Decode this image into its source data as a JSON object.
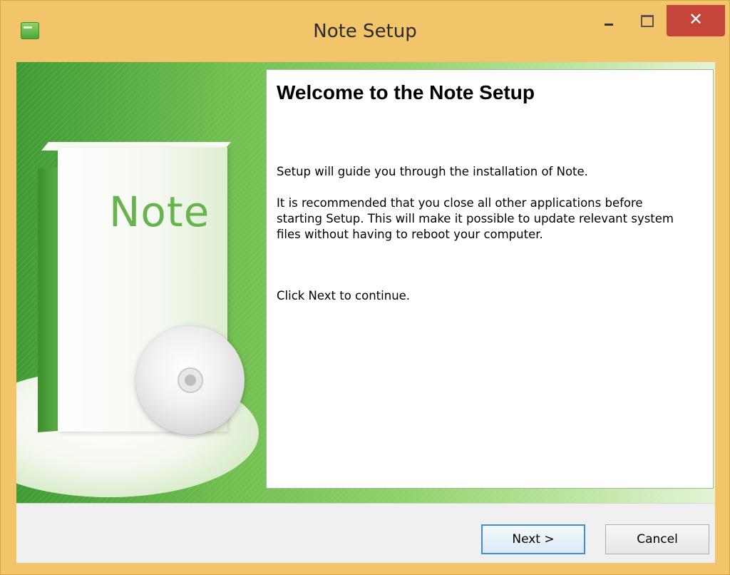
{
  "window": {
    "title": "Note Setup",
    "close_glyph": "✕"
  },
  "banner": {
    "box_brand": "Note"
  },
  "content": {
    "heading": "Welcome to the Note Setup",
    "paragraph_1": "Setup will guide you through the installation of Note.",
    "paragraph_2": "It is recommended that you close all other applications before starting Setup. This will make it possible to update relevant system files without having to reboot your computer.",
    "paragraph_3": "Click Next to continue."
  },
  "buttons": {
    "next_label": "Next >",
    "cancel_label": "Cancel"
  },
  "colors": {
    "titlebar": "#f2c56a",
    "close_button": "#c7443a",
    "banner_green": "#6fbe4f",
    "default_button_border": "#3c8ed6"
  },
  "icons": {
    "app": "installer-app-icon",
    "minimize": "minimize-icon",
    "maximize": "maximize-icon",
    "close": "close-icon"
  }
}
